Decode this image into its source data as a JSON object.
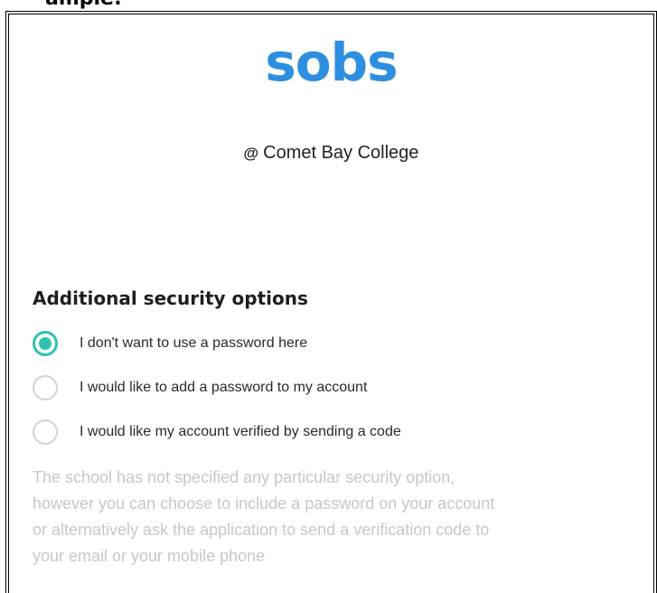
{
  "header_fragment": "ample:",
  "brand": {
    "logo_text": "sobs",
    "logo_color": "#2e8fe0"
  },
  "school": {
    "at_symbol": "@",
    "name": "Comet Bay College"
  },
  "security": {
    "heading": "Additional security options",
    "accent_color": "#2ec2b3",
    "options": [
      {
        "label": "I don't want to use a password here",
        "selected": true
      },
      {
        "label": "I would like to add a password to my account",
        "selected": false
      },
      {
        "label": "I would like my account verified by sending a code",
        "selected": false
      }
    ],
    "help_lines": [
      "The school has not specified any particular security option,",
      "however you can choose to include a password on your account",
      "or alternatively ask the application to send a verification code to",
      "your email or your mobile phone"
    ]
  }
}
